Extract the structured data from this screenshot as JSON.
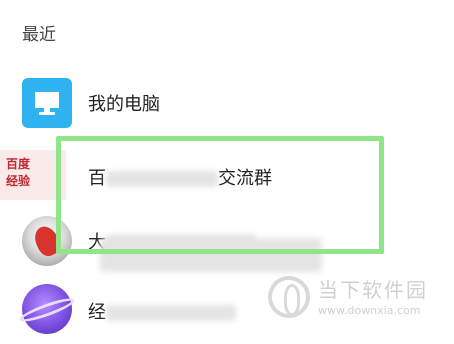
{
  "section": {
    "title": "最近"
  },
  "recent_list": [
    {
      "label": "我的电脑",
      "icon": "computer-icon"
    },
    {
      "label_start": "百",
      "label_end": "交流群",
      "avatar_text": "百度\n经验",
      "icon": "group-avatar"
    },
    {
      "label_start": "大",
      "icon": "rocket-avatar"
    },
    {
      "label_start": "经",
      "icon": "planet-avatar"
    }
  ],
  "highlight_color": "#8ee689",
  "accent_color": "#2fb2f0",
  "watermark": {
    "name": "当下软件园",
    "url": "www.downxia.com"
  }
}
